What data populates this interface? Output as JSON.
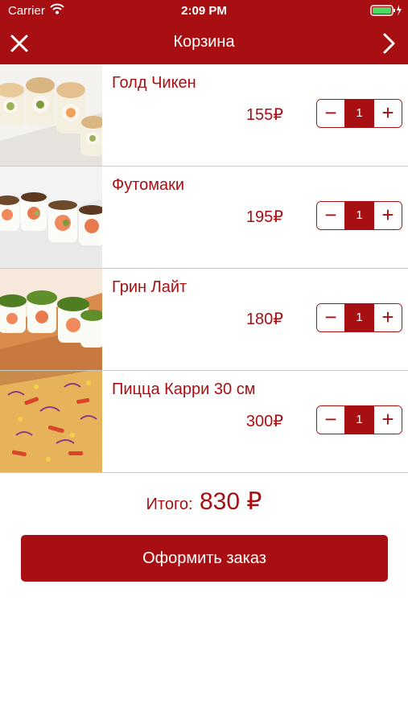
{
  "status_bar": {
    "carrier": "Carrier",
    "time": "2:09 PM",
    "icons": [
      "wifi-icon",
      "battery-icon",
      "charging-bolt-icon"
    ]
  },
  "nav": {
    "title": "Корзина",
    "left_icon": "close-icon",
    "right_icon": "chevron-right-icon"
  },
  "cart": {
    "items": [
      {
        "name": "Голд Чикен",
        "price": "155₽",
        "quantity": "1",
        "image": "sushi-roll-photo"
      },
      {
        "name": "Футомаки",
        "price": "195₽",
        "quantity": "1",
        "image": "sushi-roll-photo"
      },
      {
        "name": "Грин Лайт",
        "price": "180₽",
        "quantity": "1",
        "image": "sushi-roll-photo"
      },
      {
        "name": "Пицца Карри 30 см",
        "price": "300₽",
        "quantity": "1",
        "image": "pizza-photo"
      }
    ],
    "stepper": {
      "minus": "−",
      "plus": "+"
    }
  },
  "total": {
    "label": "Итого:",
    "value": "830 ₽"
  },
  "order_button": {
    "label": "Оформить заказ"
  },
  "colors": {
    "accent": "#a80f12",
    "divider": "#c9c9c9",
    "background": "#ffffff"
  }
}
